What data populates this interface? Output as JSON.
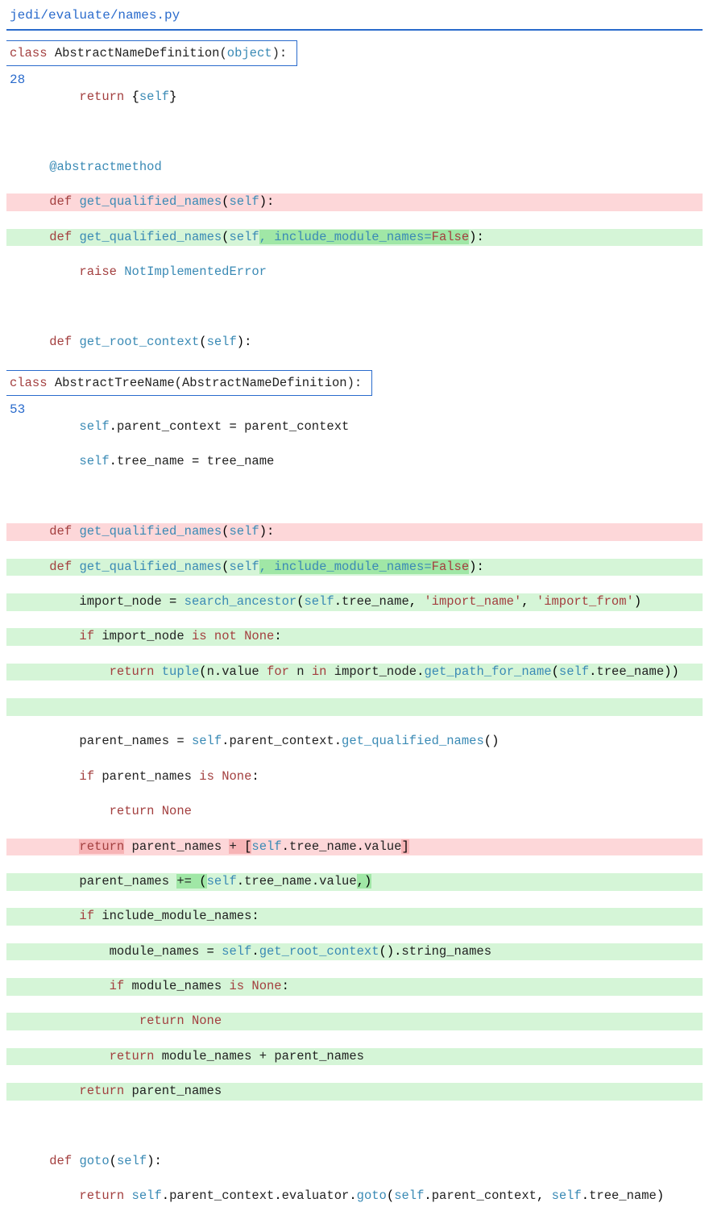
{
  "file_path": "jedi/evaluate/names.py",
  "class1": {
    "keyword": "class",
    "name": "AbstractNameDefinition",
    "base": "object"
  },
  "lineno1": "28",
  "block1": {
    "return_kw": "return",
    "self": "self",
    "decorator": "@abstractmethod",
    "def_kw": "def",
    "fn_name": "get_qualified_names",
    "param_self": "self",
    "param_new": ", include_module_names=",
    "param_false": "False",
    "raise_kw": "raise",
    "raise_exc": "NotImplementedError",
    "fn2_name": "get_root_context"
  },
  "class2": {
    "keyword": "class",
    "name": "AbstractTreeName",
    "base": "AbstractNameDefinition"
  },
  "lineno2": "53",
  "block2": {
    "self": "self",
    "parent_context": "parent_context",
    "tree_name": "tree_name",
    "def_kw": "def",
    "fn_name": "get_qualified_names",
    "param_self": "self",
    "param_new": ", include_module_names=",
    "param_false": "False",
    "import_node": "import_node",
    "search_ancestor": "search_ancestor",
    "str_import_name": "'import_name'",
    "str_import_from": "'import_from'",
    "if_kw": "if",
    "is_kw": "is",
    "not_kw": "not",
    "none": "None",
    "return_kw": "return",
    "tuple_fn": "tuple",
    "value_attr": "value",
    "for_kw": "for",
    "in_kw": "in",
    "n_var": "n",
    "get_path_for_name": "get_path_for_name",
    "parent_names": "parent_names",
    "get_qualified_names_call": "get_qualified_names",
    "plus": "+",
    "plus_eq": "+=",
    "include_module_names": "include_module_names",
    "module_names": "module_names",
    "get_root_context": "get_root_context",
    "string_names": "string_names",
    "fn_goto": "goto",
    "evaluator": "evaluator",
    "goto_call": "goto"
  }
}
